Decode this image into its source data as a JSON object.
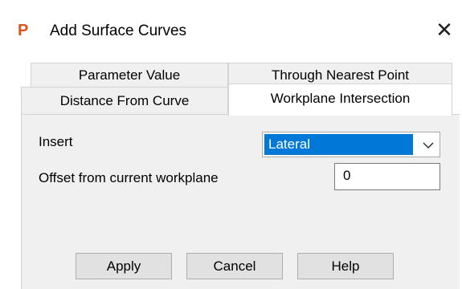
{
  "window": {
    "title": "Add Surface Curves",
    "app_icon": "P",
    "close_glyph": "✕"
  },
  "tabs": {
    "parameter_value": "Parameter Value",
    "through_nearest_point": "Through Nearest Point",
    "distance_from_curve": "Distance From Curve",
    "workplane_intersection": "Workplane Intersection",
    "active": "Workplane Intersection"
  },
  "form": {
    "insert_label": "Insert",
    "insert_value": "Lateral",
    "offset_label": "Offset from current workplane",
    "offset_value": "0"
  },
  "buttons": {
    "apply": "Apply",
    "cancel": "Cancel",
    "help": "Help"
  },
  "colors": {
    "accent": "#0078d7",
    "app_icon": "#e0531f",
    "panel_bg": "#f0f0f0"
  }
}
